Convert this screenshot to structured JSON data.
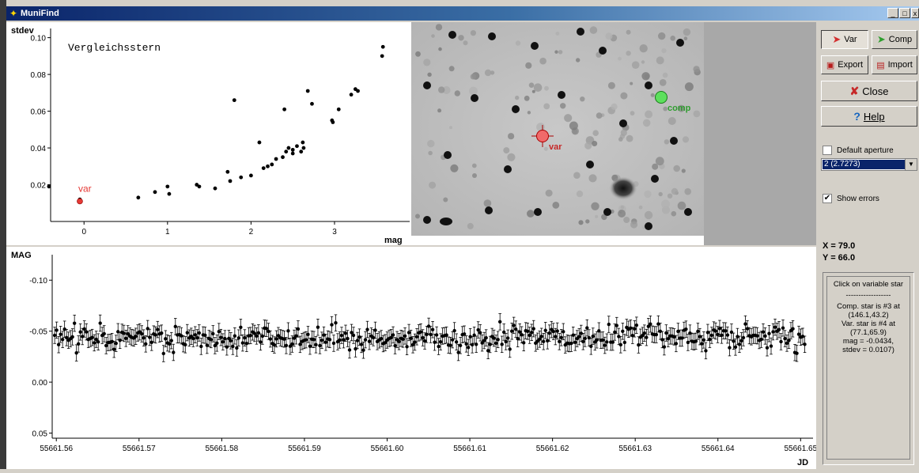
{
  "window": {
    "title": "MuniFind",
    "min": "_",
    "max": "□",
    "close": "x"
  },
  "scatter": {
    "title": "Vergleichsstern",
    "ylabel": "stdev",
    "xlabel": "mag",
    "var_label": "var"
  },
  "image": {
    "var_label": "var",
    "comp_label": "comp"
  },
  "lightcurve": {
    "ylabel": "MAG",
    "xlabel": "JD"
  },
  "chart_data": [
    {
      "type": "scatter",
      "title": "Vergleichsstern",
      "xlabel": "mag",
      "ylabel": "stdev",
      "xlim": [
        -0.4,
        3.9
      ],
      "ylim": [
        0.0,
        0.105
      ],
      "xticks": [
        "0",
        "1",
        "2",
        "3"
      ],
      "yticks": [
        "0.02",
        "0.04",
        "0.06",
        "0.08",
        "0.10"
      ],
      "x": [
        -0.42,
        -0.05,
        0.65,
        0.85,
        1.0,
        1.02,
        1.35,
        1.38,
        1.57,
        1.72,
        1.75,
        1.8,
        1.88,
        2.0,
        2.1,
        2.15,
        2.2,
        2.25,
        2.3,
        2.38,
        2.4,
        2.42,
        2.45,
        2.5,
        2.5,
        2.55,
        2.6,
        2.62,
        2.63,
        2.68,
        2.73,
        2.97,
        2.98,
        3.05,
        3.2,
        3.25,
        3.28,
        3.57,
        3.58
      ],
      "y": [
        0.019,
        0.012,
        0.013,
        0.016,
        0.019,
        0.015,
        0.02,
        0.019,
        0.018,
        0.027,
        0.022,
        0.066,
        0.024,
        0.025,
        0.043,
        0.029,
        0.03,
        0.031,
        0.034,
        0.035,
        0.061,
        0.038,
        0.04,
        0.037,
        0.039,
        0.041,
        0.038,
        0.043,
        0.04,
        0.071,
        0.064,
        0.055,
        0.054,
        0.061,
        0.069,
        0.072,
        0.071,
        0.09,
        0.095
      ],
      "highlight": {
        "name": "var",
        "x": -0.05,
        "y": 0.011,
        "color": "#e53935"
      }
    },
    {
      "type": "scatter",
      "ylabel": "MAG",
      "xlabel": "JD",
      "xlim": [
        55661.5595,
        55661.6515
      ],
      "ylim": [
        0.055,
        -0.125
      ],
      "xticks": [
        "55661.56",
        "55661.57",
        "55661.58",
        "55661.59",
        "55661.60",
        "55661.61",
        "55661.62",
        "55661.63",
        "55661.64",
        "55661.65"
      ],
      "yticks": [
        "-0.10",
        "-0.05",
        "0.00",
        "0.05"
      ],
      "jd_start": 55661.5598,
      "jd_end": 55661.6505,
      "mag_mean": -0.043,
      "mag_spread": 0.012,
      "error": 0.008,
      "points": 380
    }
  ],
  "sidebar": {
    "var_label": "Var",
    "comp_label": "Comp",
    "export_label": "Export",
    "import_label": "Import",
    "close_label": "Close",
    "help_label": "Help",
    "default_aperture": "Default aperture",
    "aperture_value": "2 (2.7273)",
    "show_errors": "Show errors",
    "x_readout": "X = 79.0",
    "y_readout": "Y = 66.0",
    "info_lines": [
      "Click on variable star",
      "------------------",
      "Comp. star is #3 at (146.1,43.2)",
      "Var. star is #4 at (77.1,65.9)",
      "mag = -0.0434,",
      "stdev = 0.0107)"
    ]
  },
  "colors": {
    "var": "#e53935",
    "comp": "#2e9e2e",
    "selection": "#0a246a"
  }
}
